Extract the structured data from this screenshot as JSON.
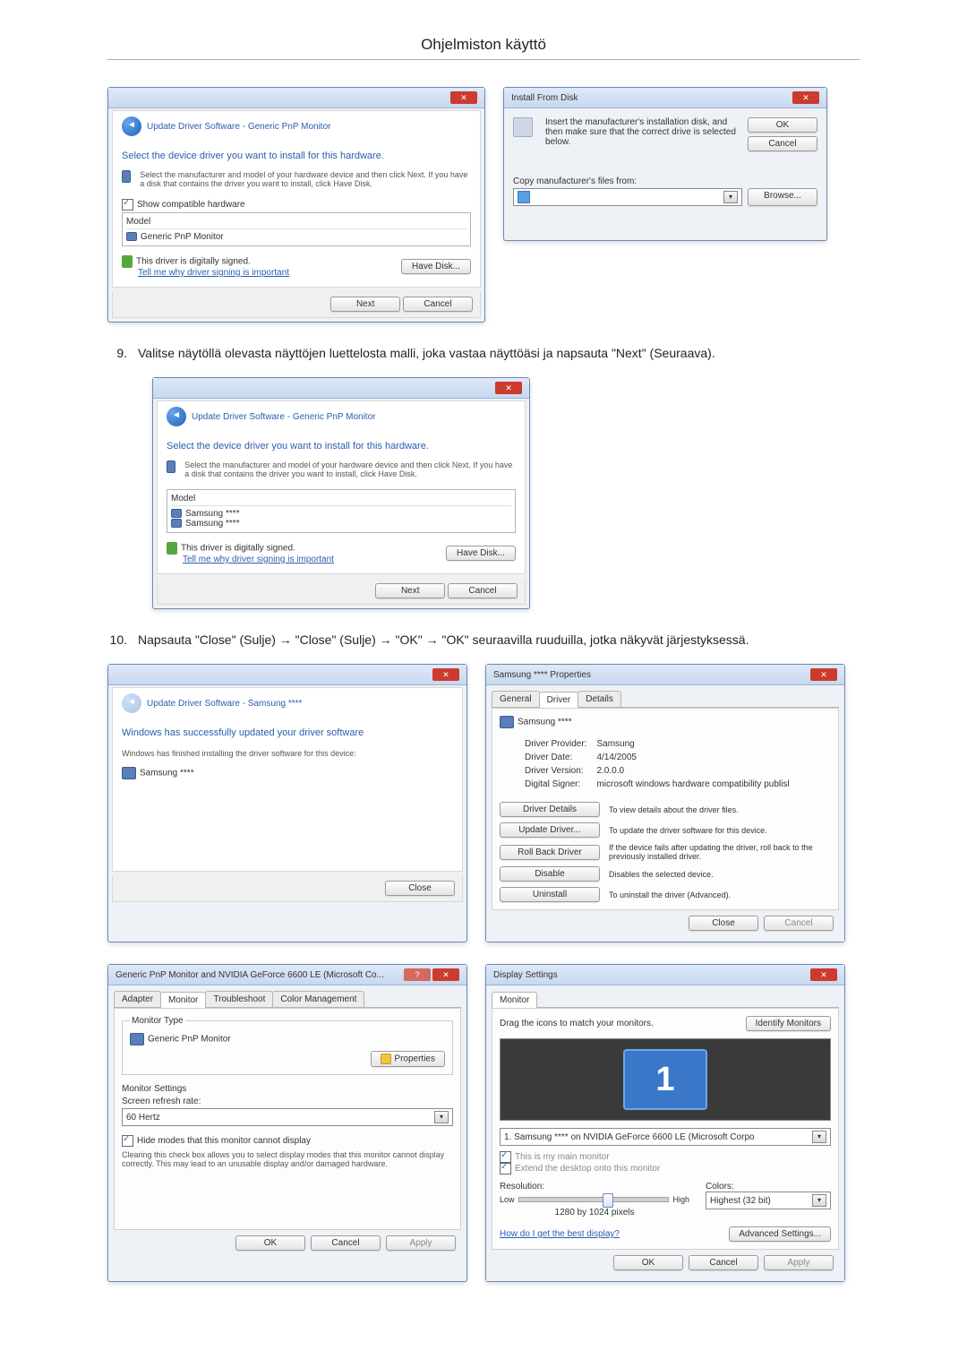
{
  "page_title": "Ohjelmiston käyttö",
  "step9": {
    "num": "9.",
    "text": "Valitse näytöllä olevasta näyttöjen luettelosta malli, joka vastaa näyttöäsi ja napsauta \"Next\" (Seuraava)."
  },
  "step10": {
    "num": "10.",
    "text": "Napsauta \"Close\" (Sulje) → \"Close\" (Sulje) → \"OK\" → \"OK\" seuraavilla ruuduilla, jotka näkyvät järjestyksessä."
  },
  "dlg_update1": {
    "crumb": "Update Driver Software - Generic PnP Monitor",
    "heading": "Select the device driver you want to install for this hardware.",
    "instr": "Select the manufacturer and model of your hardware device and then click Next. If you have a disk that contains the driver you want to install, click Have Disk.",
    "chk": "Show compatible hardware",
    "model_hdr": "Model",
    "model_item": "Generic PnP Monitor",
    "signed": "This driver is digitally signed.",
    "tell": "Tell me why driver signing is important",
    "have_disk": "Have Disk...",
    "next": "Next",
    "cancel": "Cancel"
  },
  "dlg_install": {
    "title": "Install From Disk",
    "instr": "Insert the manufacturer's installation disk, and then make sure that the correct drive is selected below.",
    "copy": "Copy manufacturer's files from:",
    "ok": "OK",
    "cancel": "Cancel",
    "browse": "Browse..."
  },
  "dlg_update2": {
    "crumb": "Update Driver Software - Generic PnP Monitor",
    "heading": "Select the device driver you want to install for this hardware.",
    "instr": "Select the manufacturer and model of your hardware device and then click Next. If you have a disk that contains the driver you want to install, click Have Disk.",
    "model_hdr": "Model",
    "model1": "Samsung ****",
    "model2": "Samsung ****",
    "signed": "This driver is digitally signed.",
    "tell": "Tell me why driver signing is important",
    "have_disk": "Have Disk...",
    "next": "Next",
    "cancel": "Cancel"
  },
  "dlg_success": {
    "crumb": "Update Driver Software - Samsung ****",
    "heading": "Windows has successfully updated your driver software",
    "sub": "Windows has finished installing the driver software for this device:",
    "device": "Samsung ****",
    "close": "Close"
  },
  "dlg_props": {
    "title": "Samsung **** Properties",
    "tab_general": "General",
    "tab_driver": "Driver",
    "tab_details": "Details",
    "device": "Samsung ****",
    "lbl_provider": "Driver Provider:",
    "val_provider": "Samsung",
    "lbl_date": "Driver Date:",
    "val_date": "4/14/2005",
    "lbl_version": "Driver Version:",
    "val_version": "2.0.0.0",
    "lbl_signer": "Digital Signer:",
    "val_signer": "microsoft windows hardware compatibility publisl",
    "btn_details": "Driver Details",
    "txt_details": "To view details about the driver files.",
    "btn_update": "Update Driver...",
    "txt_update": "To update the driver software for this device.",
    "btn_rollback": "Roll Back Driver",
    "txt_rollback": "If the device fails after updating the driver, roll back to the previously installed driver.",
    "btn_disable": "Disable",
    "txt_disable": "Disables the selected device.",
    "btn_uninstall": "Uninstall",
    "txt_uninstall": "To uninstall the driver (Advanced).",
    "close": "Close",
    "cancel": "Cancel"
  },
  "dlg_monitor": {
    "title": "Generic PnP Monitor and NVIDIA GeForce 6600 LE (Microsoft Co...",
    "tab_adapter": "Adapter",
    "tab_monitor": "Monitor",
    "tab_trouble": "Troubleshoot",
    "tab_color": "Color Management",
    "grp_type": "Monitor Type",
    "type_val": "Generic PnP Monitor",
    "btn_props": "Properties",
    "grp_settings": "Monitor Settings",
    "lbl_refresh": "Screen refresh rate:",
    "val_refresh": "60 Hertz",
    "chk_hide": "Hide modes that this monitor cannot display",
    "hide_desc": "Clearing this check box allows you to select display modes that this monitor cannot display correctly. This may lead to an unusable display and/or damaged hardware.",
    "ok": "OK",
    "cancel": "Cancel",
    "apply": "Apply"
  },
  "dlg_display": {
    "title": "Display Settings",
    "tab_monitor": "Monitor",
    "drag": "Drag the icons to match your monitors.",
    "identify": "Identify Monitors",
    "mon_label": "1",
    "sel": "1. Samsung **** on NVIDIA GeForce 6600 LE (Microsoft Corpo",
    "chk_main": "This is my main monitor",
    "chk_extend": "Extend the desktop onto this monitor",
    "lbl_res": "Resolution:",
    "low": "Low",
    "high": "High",
    "res_val": "1280 by 1024 pixels",
    "lbl_colors": "Colors:",
    "colors_val": "Highest (32 bit)",
    "help": "How do I get the best display?",
    "adv": "Advanced Settings...",
    "ok": "OK",
    "cancel": "Cancel",
    "apply": "Apply"
  }
}
